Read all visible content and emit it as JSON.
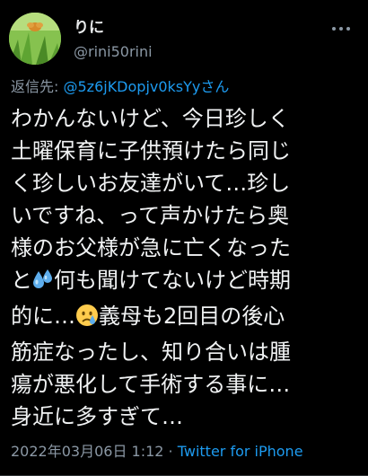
{
  "author": {
    "display_name": "りに",
    "handle": "@rini50rini"
  },
  "reply": {
    "prefix": "返信先: ",
    "to": "@5z6jKDopjv0ksYyさん"
  },
  "body": {
    "line1": "わかんないけど、今日珍しく",
    "line2": "土曜保育に子供預けたら同じ",
    "line3": "く珍しいお友達がいて…珍し",
    "line4": "いですね、って声かけたら奥",
    "line5": "様のお父様が急に亡くなった",
    "line6a": "と",
    "line6b": "何も聞けてないけど時期",
    "line7a": "的に…",
    "line7b": "義母も2回目の後心",
    "line8": "筋症なったし、知り合いは腫",
    "line9": "瘍が悪化して手術する事に…",
    "line10": "身近に多すぎて…"
  },
  "meta": {
    "timestamp": "2022年03月06日 1:12",
    "separator": " · ",
    "source": "Twitter for iPhone"
  },
  "icons": {
    "avatar": "avatar-photo",
    "more": "more-options-icon",
    "emoji_sweat": "sweat-droplets-emoji",
    "emoji_crying": "crying-face-emoji"
  },
  "colors": {
    "background": "#000000",
    "text": "#e7e9ea",
    "secondary": "#8b98a5",
    "link": "#1d9bf0"
  }
}
